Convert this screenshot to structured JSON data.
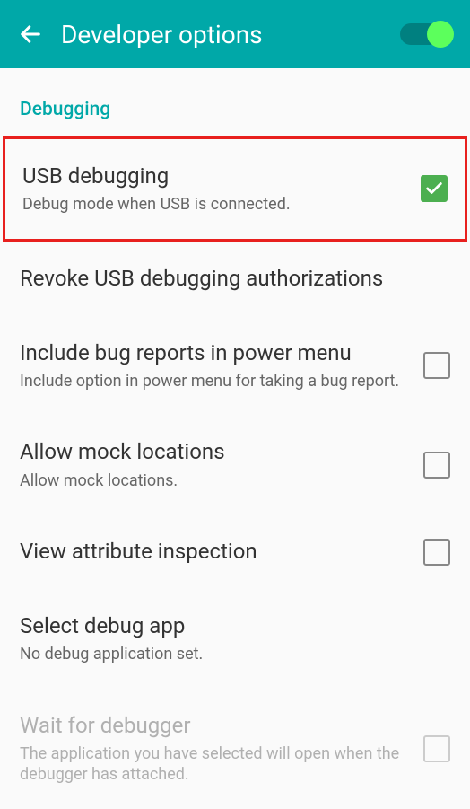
{
  "header": {
    "title": "Developer options",
    "toggle_on": true
  },
  "section": {
    "label": "Debugging"
  },
  "settings": {
    "usb_debugging": {
      "title": "USB debugging",
      "subtitle": "Debug mode when USB is connected.",
      "checked": true,
      "highlighted": true
    },
    "revoke": {
      "title": "Revoke USB debugging authorizations"
    },
    "bug_reports": {
      "title": "Include bug reports in power menu",
      "subtitle": "Include option in power menu for taking a bug report.",
      "checked": false
    },
    "mock_locations": {
      "title": "Allow mock locations",
      "subtitle": "Allow mock locations.",
      "checked": false
    },
    "attribute_inspection": {
      "title": "View attribute inspection",
      "checked": false
    },
    "debug_app": {
      "title": "Select debug app",
      "subtitle": "No debug application set."
    },
    "wait_debugger": {
      "title": "Wait for debugger",
      "subtitle": "The application you have selected will open when the debugger has attached.",
      "checked": false,
      "disabled": true
    }
  }
}
